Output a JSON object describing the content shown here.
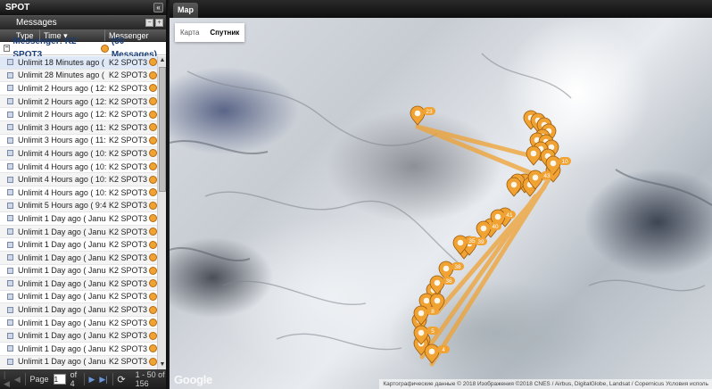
{
  "left_panel": {
    "title": "SPOT",
    "collapse_icon": "«",
    "messages_title": "Messages",
    "columns": {
      "type": "Type",
      "time": "Time ▾",
      "messenger": "Messenger"
    },
    "group_label": "Messenger: K2 SPOT3",
    "group_count": "(50 Messages)",
    "rows": [
      {
        "type": "Unlimit...",
        "time": "18 Minutes ago ( 2:09...",
        "messenger": "K2 SPOT3",
        "selected": true
      },
      {
        "type": "Unlimit...",
        "time": "28 Minutes ago ( 2:00...",
        "messenger": "K2 SPOT3"
      },
      {
        "type": "Unlimit...",
        "time": "2 Hours ago ( 12:40 ...",
        "messenger": "K2 SPOT3"
      },
      {
        "type": "Unlimit...",
        "time": "2 Hours ago ( 12:30 ...",
        "messenger": "K2 SPOT3"
      },
      {
        "type": "Unlimit...",
        "time": "2 Hours ago ( 12:20 ...",
        "messenger": "K2 SPOT3"
      },
      {
        "type": "Unlimit...",
        "time": "3 Hours ago ( 11:10 ...",
        "messenger": "K2 SPOT3"
      },
      {
        "type": "Unlimit...",
        "time": "3 Hours ago ( 11:00 ...",
        "messenger": "K2 SPOT3"
      },
      {
        "type": "Unlimit...",
        "time": "4 Hours ago ( 10:50 ...",
        "messenger": "K2 SPOT3"
      },
      {
        "type": "Unlimit...",
        "time": "4 Hours ago ( 10:31 ...",
        "messenger": "K2 SPOT3"
      },
      {
        "type": "Unlimit...",
        "time": "4 Hours ago ( 10:21 ...",
        "messenger": "K2 SPOT3"
      },
      {
        "type": "Unlimit...",
        "time": "4 Hours ago ( 10:11 ...",
        "messenger": "K2 SPOT3"
      },
      {
        "type": "Unlimit...",
        "time": "5 Hours ago ( 9:41 A...",
        "messenger": "K2 SPOT3"
      },
      {
        "type": "Unlimit...",
        "time": "1 Day ago ( January ...",
        "messenger": "K2 SPOT3"
      },
      {
        "type": "Unlimit...",
        "time": "1 Day ago ( January ...",
        "messenger": "K2 SPOT3"
      },
      {
        "type": "Unlimit...",
        "time": "1 Day ago ( January ...",
        "messenger": "K2 SPOT3"
      },
      {
        "type": "Unlimit...",
        "time": "1 Day ago ( January ...",
        "messenger": "K2 SPOT3"
      },
      {
        "type": "Unlimit...",
        "time": "1 Day ago ( January ...",
        "messenger": "K2 SPOT3"
      },
      {
        "type": "Unlimit...",
        "time": "1 Day ago ( January ...",
        "messenger": "K2 SPOT3"
      },
      {
        "type": "Unlimit...",
        "time": "1 Day ago ( January ...",
        "messenger": "K2 SPOT3"
      },
      {
        "type": "Unlimit...",
        "time": "1 Day ago ( January ...",
        "messenger": "K2 SPOT3"
      },
      {
        "type": "Unlimit...",
        "time": "1 Day ago ( January ...",
        "messenger": "K2 SPOT3"
      },
      {
        "type": "Unlimit...",
        "time": "1 Day ago ( January ...",
        "messenger": "K2 SPOT3"
      },
      {
        "type": "Unlimit...",
        "time": "1 Day ago ( January ...",
        "messenger": "K2 SPOT3"
      },
      {
        "type": "Unlimit...",
        "time": "1 Day ago ( January",
        "messenger": "K2 SPOT3"
      }
    ],
    "pager": {
      "first_icon": "|◀",
      "prev_icon": "◀",
      "page_label": "Page",
      "page_value": "1",
      "of_label": "of 4",
      "next_icon": "▶",
      "last_icon": "▶|",
      "refresh_icon": "⟳",
      "range": "1 - 50 of 156"
    }
  },
  "map_panel": {
    "tab_label": "Map",
    "map_types": [
      "Карта",
      "Спутник"
    ],
    "active_map_type": "Спутник",
    "google_logo": "Google",
    "attribution": "Картографические данные © 2018 Изображения ©2018 CNES / Airbus, DigitalGlobe, Landsat / Copernicus    Условия исполь",
    "marker_labels": [
      "23",
      "10",
      "43",
      "41",
      "40",
      "39",
      "38",
      "36",
      "35",
      "8",
      "5",
      "4"
    ],
    "colors": {
      "marker": "#f0a233",
      "track": "#f0a233"
    }
  }
}
